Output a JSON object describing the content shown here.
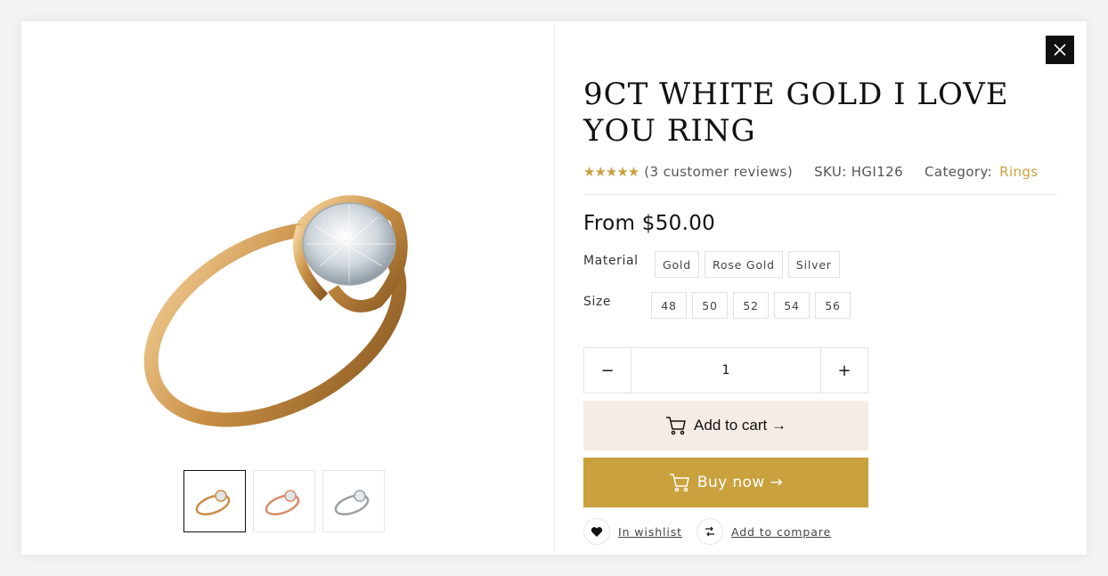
{
  "product": {
    "title": "9CT WHITE GOLD I LOVE YOU RING",
    "rating_stars": "★★★★★",
    "reviews": "(3 customer reviews)",
    "sku_label": "SKU:",
    "sku": "HGI126",
    "category_label": "Category:",
    "category": "Rings",
    "price": "From $50.00"
  },
  "options": {
    "material_label": "Material",
    "materials": [
      "Gold",
      "Rose Gold",
      "Silver"
    ],
    "size_label": "Size",
    "sizes": [
      "48",
      "50",
      "52",
      "54",
      "56"
    ]
  },
  "quantity": {
    "value": "1",
    "minus": "−",
    "plus": "+"
  },
  "actions": {
    "add_to_cart": "Add to cart →",
    "buy_now": "Buy now →",
    "wishlist": "In wishlist",
    "compare": "Add to compare"
  },
  "colors": {
    "accent": "#c9a13e",
    "cart_bg": "#f5ece6",
    "dark": "#111111"
  },
  "gallery": {
    "thumbnails": [
      "gold-ring",
      "rose-gold-ring",
      "silver-ring"
    ],
    "active_index": 0
  }
}
